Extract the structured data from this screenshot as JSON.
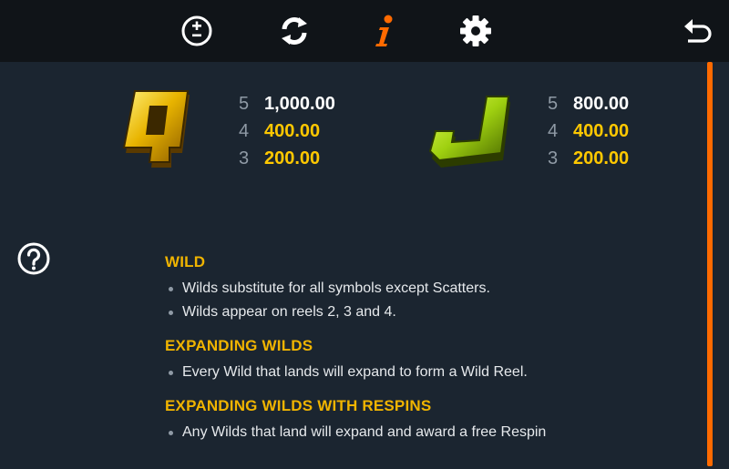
{
  "toolbar": {
    "icons": [
      "plus-minus-icon",
      "refresh-icon",
      "info-icon",
      "gear-icon",
      "back-icon"
    ],
    "active_color": "#ff6a00"
  },
  "paytables": [
    {
      "symbol": "Q",
      "rows": [
        {
          "count": "5",
          "value": "1,000.00"
        },
        {
          "count": "4",
          "value": "400.00"
        },
        {
          "count": "3",
          "value": "200.00"
        }
      ]
    },
    {
      "symbol": "J",
      "rows": [
        {
          "count": "5",
          "value": "800.00"
        },
        {
          "count": "4",
          "value": "400.00"
        },
        {
          "count": "3",
          "value": "200.00"
        }
      ]
    }
  ],
  "rules": [
    {
      "title": "WILD",
      "bullets": [
        "Wilds substitute for all symbols except Scatters.",
        "Wilds appear on reels 2, 3 and 4."
      ]
    },
    {
      "title": "EXPANDING WILDS",
      "bullets": [
        "Every Wild that lands will expand to form a Wild Reel."
      ]
    },
    {
      "title": "EXPANDING WILDS WITH RESPINS",
      "bullets": [
        "Any Wilds that land will expand and award a free Respin"
      ]
    }
  ]
}
